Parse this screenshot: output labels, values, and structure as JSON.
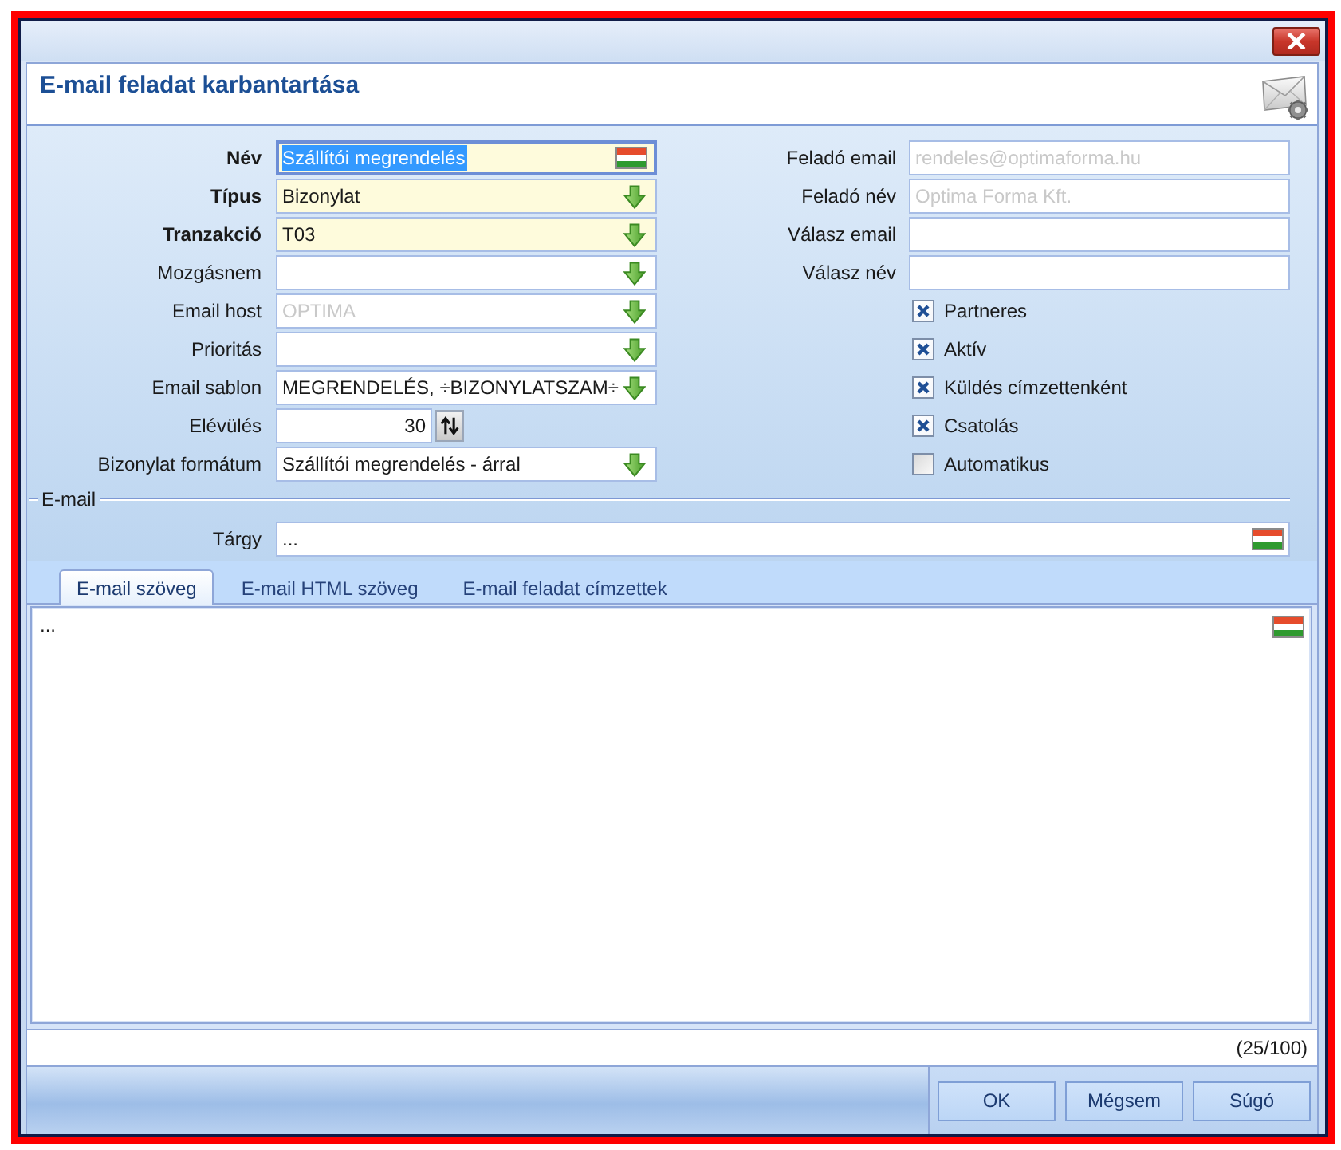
{
  "window": {
    "title": "E-mail feladat karbantartása"
  },
  "left_fields": [
    {
      "label": "Név",
      "kind": "localized",
      "value": "Szállítói megrendelés",
      "required": true,
      "focused": true
    },
    {
      "label": "Típus",
      "kind": "dropdown",
      "value": "Bizonylat",
      "required": true,
      "focused": false
    },
    {
      "label": "Tranzakció",
      "kind": "dropdown",
      "value": "T03",
      "required": true,
      "focused": false
    },
    {
      "label": "Mozgásnem",
      "kind": "dropdown",
      "required": false,
      "focused": false
    },
    {
      "label": "Email host",
      "kind": "dropdown",
      "placeholder": "OPTIMA",
      "required": false,
      "focused": false
    },
    {
      "label": "Prioritás",
      "kind": "dropdown",
      "required": false,
      "focused": false
    },
    {
      "label": "Email sablon",
      "kind": "dropdown",
      "value": "MEGRENDELÉS, ÷BIZONYLATSZAM÷",
      "required": false,
      "focused": false
    },
    {
      "label": "Elévülés",
      "kind": "number",
      "value": "30",
      "required": false,
      "focused": false
    },
    {
      "label": "Bizonylat formátum",
      "kind": "dropdown",
      "value": "Szállítói megrendelés - árral",
      "required": false,
      "focused": false
    }
  ],
  "right_fields": [
    {
      "label": "Feladó email",
      "placeholder": "rendeles@optimaforma.hu"
    },
    {
      "label": "Feladó név",
      "placeholder": "Optima Forma Kft."
    },
    {
      "label": "Válasz email"
    },
    {
      "label": "Válasz név"
    }
  ],
  "options": [
    {
      "label": "Partneres",
      "checked": true
    },
    {
      "label": "Aktív",
      "checked": true
    },
    {
      "label": "Küldés címzettenként",
      "checked": true
    },
    {
      "label": "Csatolás",
      "checked": true
    },
    {
      "label": "Automatikus",
      "checked": false
    }
  ],
  "email_group": {
    "title": "E-mail",
    "subject": {
      "label": "Tárgy",
      "value": "..."
    }
  },
  "tabs": [
    {
      "label": "E-mail szöveg",
      "selected": true
    },
    {
      "label": "E-mail HTML szöveg",
      "selected": false
    },
    {
      "label": "E-mail feladat címzettek",
      "selected": false
    }
  ],
  "body_text": "...",
  "counter": "(25/100)",
  "buttons": [
    "OK",
    "Mégsem",
    "Súgó"
  ]
}
